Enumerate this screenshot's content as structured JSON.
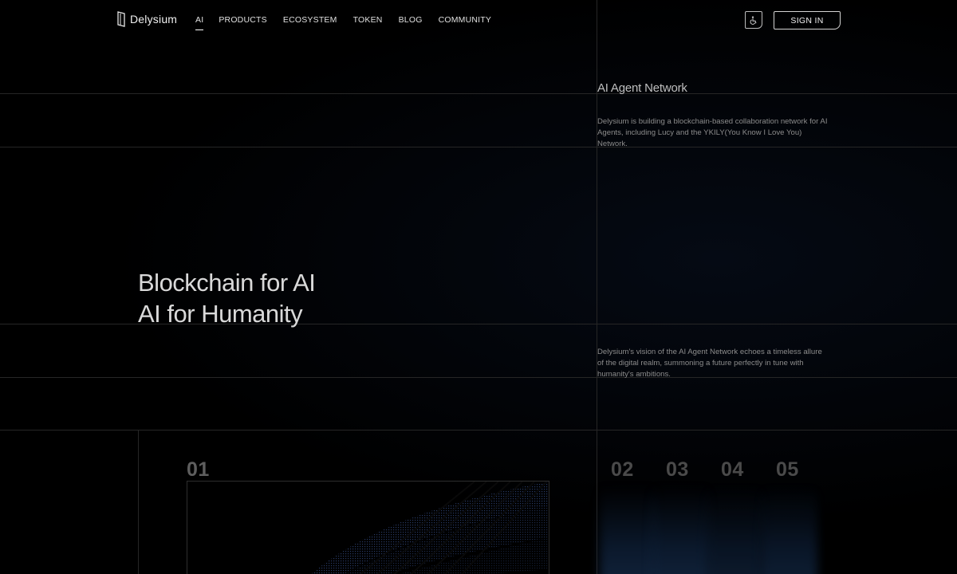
{
  "header": {
    "logo_text": "Delysium",
    "nav": [
      {
        "label": "AI",
        "active": true
      },
      {
        "label": "PRODUCTS",
        "active": false
      },
      {
        "label": "ECOSYSTEM",
        "active": false
      },
      {
        "label": "TOKEN",
        "active": false
      },
      {
        "label": "BLOG",
        "active": false
      },
      {
        "label": "COMMUNITY",
        "active": false
      }
    ],
    "icon_button": "accessibility-icon",
    "signin_label": "SIGN IN"
  },
  "hero": {
    "line1": "Blockchain for AI",
    "line2": "AI for Humanity"
  },
  "side": {
    "heading": "AI Agent Network",
    "paragraph1": "Delysium is building a blockchain-based collaboration network for AI Agents, including Lucy and the YKILY(You Know I Love You) Network.",
    "paragraph2": "Delysium's vision of the AI Agent Network echoes a timeless allure of the digital realm, summoning a future perfectly in tune with humanity's ambitions."
  },
  "sections": {
    "active": "01",
    "others": [
      "02",
      "03",
      "04",
      "05"
    ]
  },
  "colors": {
    "background": "#000000",
    "text": "#e8e8e8",
    "grid_line": "#262626",
    "number": "#4a4a4a",
    "accent_blue": "#3a5ea8"
  }
}
